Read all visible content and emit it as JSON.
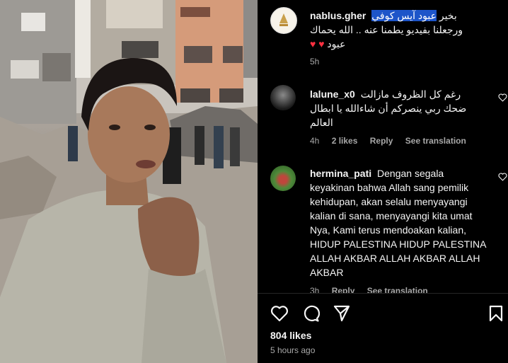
{
  "post": {
    "username": "nablus.gher",
    "caption_highlight": "عبود آيس كوفي",
    "caption_rest_line1": "بخير",
    "caption_line2": "ورجعلنا بفيديو يطمنا عنه .. الله يحماك",
    "caption_line3": "عبود",
    "caption_hearts": "♥ ♥",
    "time": "5h"
  },
  "comments": [
    {
      "username": "lalune_x0",
      "text_line1": "رغم كل الظروف مازالت",
      "text_line2": "ضحك ربي ينصركم أن شاءالله يا ابطال",
      "text_line3": "العالم",
      "time": "4h",
      "likes": "2 likes",
      "reply": "Reply",
      "translate": "See translation"
    },
    {
      "username": "hermina_pati",
      "text": "Dengan segala keyakinan bahwa Allah sang pemilik kehidupan, akan selalu menyayangi kalian di sana, menyayangi kita umat Nya, Kami terus mendoakan kalian, HIDUP PALESTINA HIDUP PALESTINA ALLAH AKBAR ALLAH AKBAR ALLAH AKBAR",
      "time": "3h",
      "reply": "Reply",
      "translate": "See translation"
    }
  ],
  "footer": {
    "likes": "804 likes",
    "time": "5 hours ago"
  },
  "icons": [
    "like-icon",
    "comment-icon",
    "share-icon",
    "save-icon",
    "heart-small-icon"
  ]
}
